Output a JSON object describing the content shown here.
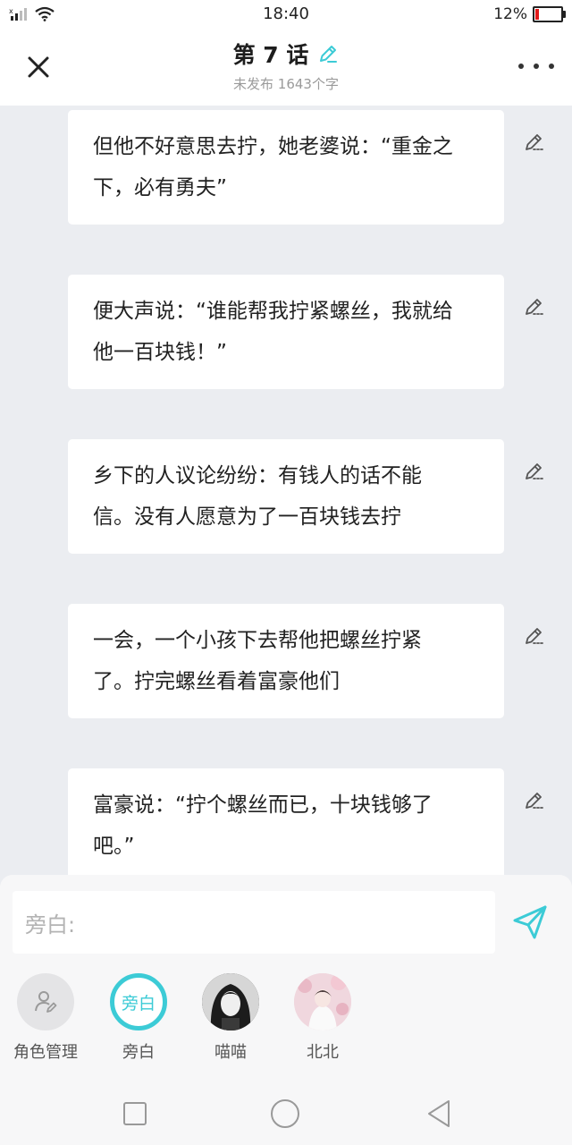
{
  "status_bar": {
    "time": "18:40",
    "battery": "12%",
    "battery_level": 0.12
  },
  "header": {
    "title": "第 7 话",
    "subtitle": "未发布 1643个字"
  },
  "messages": [
    {
      "line1": "但他不好意思去拧，她老婆说：“重金之",
      "line2": "下，必有勇夫”"
    },
    {
      "line1": "便大声说：“谁能帮我拧紧螺丝，我就给",
      "line2": "他一百块钱！”"
    },
    {
      "line1": "乡下的人议论纷纷：有钱人的话不能",
      "line2": "信。没有人愿意为了一百块钱去拧"
    },
    {
      "line1": "一会，一个小孩下去帮他把螺丝拧紧",
      "line2": "了。拧完螺丝看着富豪他们"
    },
    {
      "line1": "富豪说：“拧个螺丝而已，十块钱够了",
      "line2": "吧。”"
    }
  ],
  "input": {
    "placeholder": "旁白:"
  },
  "roles": [
    {
      "label": "角色管理",
      "avatar_text": ""
    },
    {
      "label": "旁白",
      "avatar_text": "旁白"
    },
    {
      "label": "喵喵",
      "avatar_text": ""
    },
    {
      "label": "北北",
      "avatar_text": ""
    }
  ],
  "colors": {
    "accent": "#3ccbd6",
    "background": "#ebedf1",
    "battery_low": "#e11a1a"
  },
  "icons": {
    "close": "close-icon",
    "edit_title": "pencil-icon",
    "more": "more-icon",
    "send": "send-icon",
    "edit": "edit-icon"
  }
}
